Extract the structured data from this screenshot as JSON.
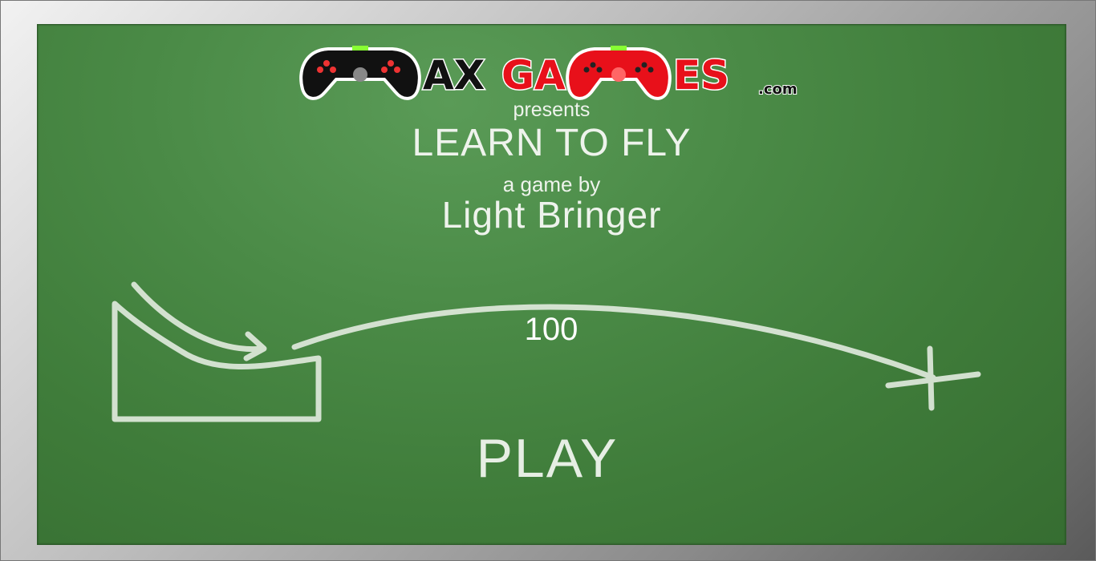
{
  "logo": {
    "brand_left": "AX",
    "brand_right_a": "GA",
    "brand_right_b": "ES",
    "brand_suffix": ".com",
    "icon": "gamepad-icon"
  },
  "intro": {
    "presents": "presents",
    "title": "LEARN TO FLY",
    "byline": "a game by",
    "author": "Light Bringer"
  },
  "diagram": {
    "distance": "100"
  },
  "menu": {
    "play_label": "PLAY"
  },
  "colors": {
    "board": "#4a8a46",
    "chalk": "#dfe9dc",
    "logo_red": "#e8101a",
    "logo_black": "#111111"
  }
}
